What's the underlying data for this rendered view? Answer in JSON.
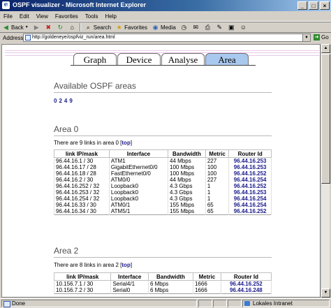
{
  "window": {
    "title": "OSPF visualizer - Microsoft Internet Explorer",
    "min": "_",
    "max": "□",
    "close": "×"
  },
  "menu": [
    "File",
    "Edit",
    "View",
    "Favorites",
    "Tools",
    "Help"
  ],
  "toolbar": {
    "back": "Back",
    "search": "Search",
    "favorites": "Favorites",
    "media": "Media"
  },
  "address": {
    "label": "Address",
    "url": "http://goldeneye/ospfviz_run/area.html",
    "go": "Go"
  },
  "status": {
    "text": "Done",
    "zone": "Lokales Intranet"
  },
  "tabs": [
    {
      "label": "Graph",
      "active": false
    },
    {
      "label": "Device",
      "active": false
    },
    {
      "label": "Analyse",
      "active": false
    },
    {
      "label": "Area",
      "active": true
    }
  ],
  "page": {
    "available_title": "Available OSPF areas",
    "area_links": [
      "0",
      "2",
      "4",
      "9"
    ],
    "top_label": "top",
    "columns": [
      "link IP/mask",
      "Interface",
      "Bandwidth",
      "Metric",
      "Router Id"
    ],
    "areas": [
      {
        "title": "Area 0",
        "info_prefix": "There are 9 links in area 0 [",
        "info_suffix": "]",
        "rows": [
          [
            "96.44.16.1 / 30",
            "ATM1",
            "44 Mbps",
            "227",
            "96.44.16.253"
          ],
          [
            "96.44.16.17 / 28",
            "GigabitEthernet0/0",
            "100 Mbps",
            "100",
            "96.44.16.253"
          ],
          [
            "96.44.16.18 / 28",
            "FastEthernet0/0",
            "100 Mbps",
            "100",
            "96.44.16.252"
          ],
          [
            "96.44.16.2 / 30",
            "ATM0/0",
            "44 Mbps",
            "227",
            "96.44.16.254"
          ],
          [
            "96.44.16.252 / 32",
            "Loopback0",
            "4.3 Gbps",
            "1",
            "96.44.16.252"
          ],
          [
            "96.44.16.253 / 32",
            "Loopback0",
            "4.3 Gbps",
            "1",
            "96.44.16.253"
          ],
          [
            "96.44.16.254 / 32",
            "Loopback0",
            "4.3 Gbps",
            "1",
            "96.44.16.254"
          ],
          [
            "96.44.16.33 / 30",
            "ATM0/1",
            "155 Mbps",
            "65",
            "96.44.16.254"
          ],
          [
            "96.44.16.34 / 30",
            "ATM5/1",
            "155 Mbps",
            "65",
            "96.44.16.252"
          ]
        ]
      },
      {
        "title": "Area 2",
        "info_prefix": "There are 8 links in area 2 [",
        "info_suffix": "]",
        "rows": [
          [
            "10.156.7.1 / 30",
            "Serial4/1",
            "6 Mbps",
            "1666",
            "96.44.16.252"
          ],
          [
            "10.156.7.2 / 30",
            "Serial0",
            "6 Mbps",
            "1666",
            "96.44.16.248"
          ]
        ]
      }
    ]
  }
}
